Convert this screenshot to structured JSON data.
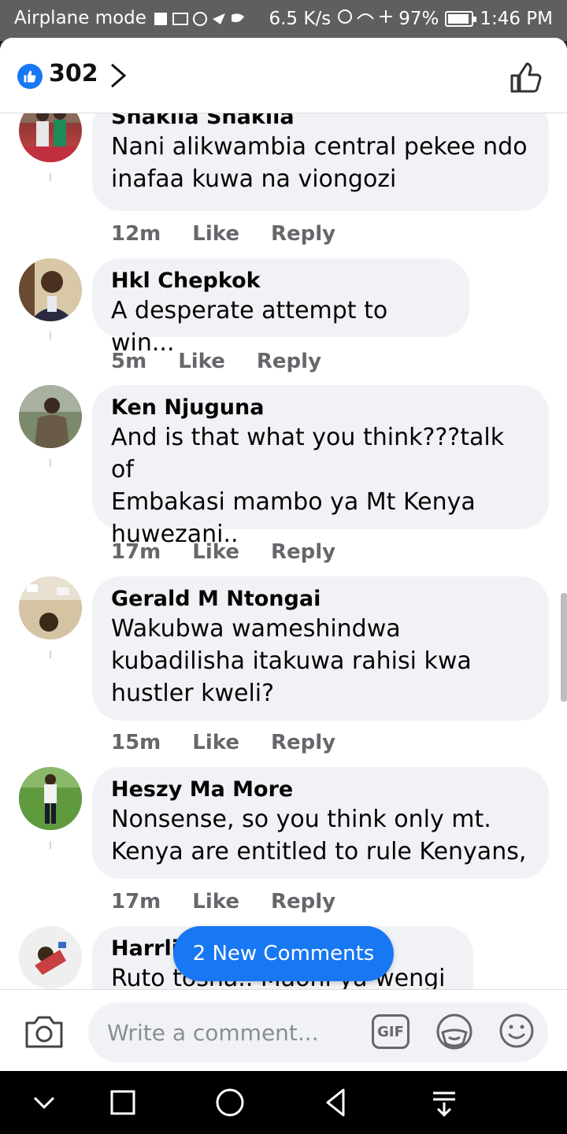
{
  "status_bar": {
    "left_text": "Airplane mode",
    "speed": "6.5 K/s",
    "battery": "97%",
    "time": "1:46 PM"
  },
  "header": {
    "like_count": "302"
  },
  "comments": [
    {
      "name": "Shakila Shakila",
      "lines": [
        "Nani alikwambia central pekee ndo",
        "inafaa kuwa na viongozi"
      ],
      "time": "12m",
      "like": "Like",
      "reply": "Reply"
    },
    {
      "name": "Hkl Chepkok",
      "lines": [
        "A desperate attempt to win..."
      ],
      "time": "5m",
      "like": "Like",
      "reply": "Reply"
    },
    {
      "name": "Ken Njuguna",
      "lines": [
        "And is that what you think???talk of",
        "Embakasi mambo ya Mt Kenya",
        "huwezani.."
      ],
      "time": "17m",
      "like": "Like",
      "reply": "Reply"
    },
    {
      "name": "Gerald M Ntongai",
      "lines": [
        "Wakubwa wameshindwa",
        "kubadilisha itakuwa rahisi kwa",
        "hustler kweli?"
      ],
      "time": "15m",
      "like": "Like",
      "reply": "Reply"
    },
    {
      "name": "Heszy Ma More",
      "lines": [
        "Nonsense, so you think only mt.",
        "Kenya are entitled to rule Kenyans,"
      ],
      "time": "17m",
      "like": "Like",
      "reply": "Reply"
    },
    {
      "name": "Harrli",
      "lines": [
        "Ruto tosha.. Maoni ya wengi"
      ]
    }
  ],
  "new_comments_label": "2 New Comments",
  "composer": {
    "placeholder": "Write a comment...",
    "gif_label": "GIF"
  },
  "colors": {
    "accent": "#1877f2",
    "bubble": "#f0f2f5",
    "meta_text": "#65676b"
  }
}
